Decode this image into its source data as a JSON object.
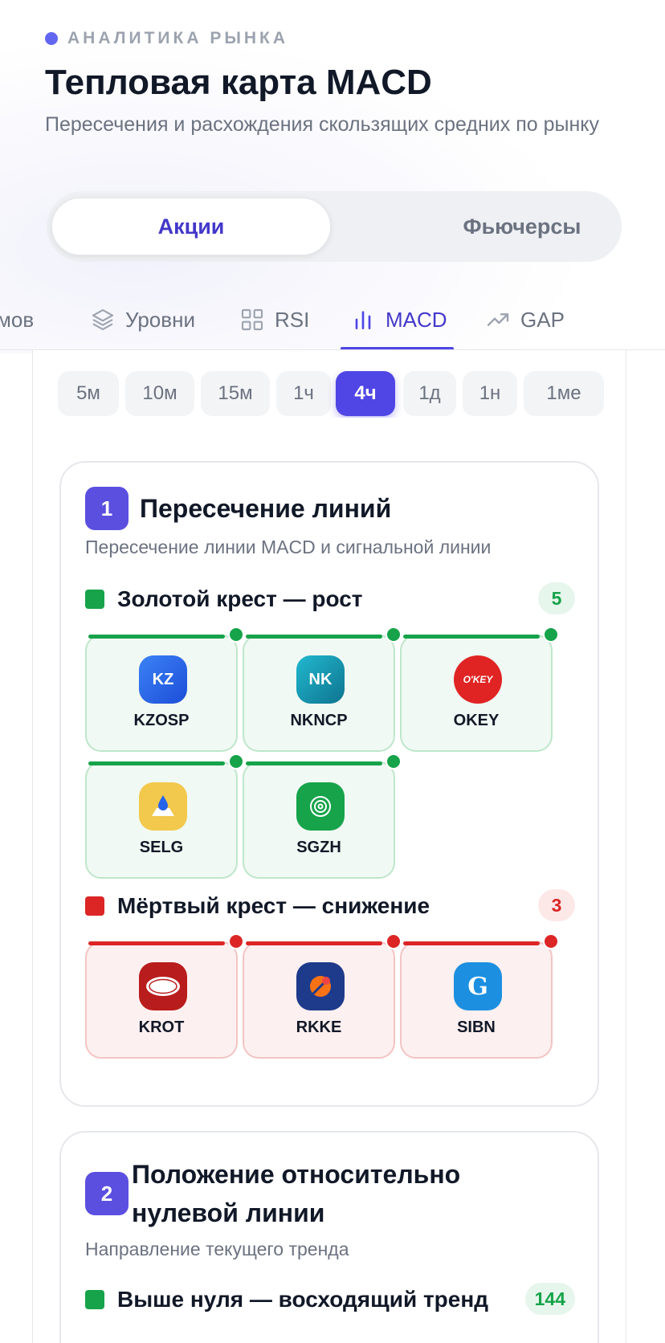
{
  "header": {
    "eyebrow": "АНАЛИТИКА РЫНКА",
    "title": "Тепловая карта MACD",
    "subtitle": "Пересечения и расхождения скользящих средних по рынку"
  },
  "segment": {
    "options": [
      "Акции",
      "Фьючерсы"
    ],
    "selected": "Акции"
  },
  "tabs": [
    {
      "label": "мов",
      "icon": ""
    },
    {
      "label": "Уровни",
      "icon": "layers-icon"
    },
    {
      "label": "RSI",
      "icon": "grid-icon"
    },
    {
      "label": "MACD",
      "icon": "bar-chart-icon",
      "active": true
    },
    {
      "label": "GAP",
      "icon": "trending-up-icon"
    }
  ],
  "timeframes": {
    "items": [
      "5м",
      "10м",
      "15м",
      "1ч",
      "4ч",
      "1д",
      "1н",
      "1ме"
    ],
    "selected": "4ч"
  },
  "sections": [
    {
      "number": "1",
      "title": "Пересечение линий",
      "subtitle": "Пересечение линии MACD и сигнальной линии",
      "groups": [
        {
          "label": "Золотой крест — рост",
          "count": "5",
          "tone": "green",
          "tickers": [
            {
              "symbol": "KZOSP",
              "logo_text": "KZ",
              "logo_color": "#2563eb"
            },
            {
              "symbol": "NKNCP",
              "logo_text": "NK",
              "logo_color": "#0891b2"
            },
            {
              "symbol": "OKEY",
              "logo_text": "O'KEY",
              "logo_color": "#dc2626"
            },
            {
              "symbol": "SELG",
              "logo_text": "",
              "logo_color": "#f2c94c"
            },
            {
              "symbol": "SGZH",
              "logo_text": "",
              "logo_color": "#16a34a"
            }
          ]
        },
        {
          "label": "Мёртвый крест — снижение",
          "count": "3",
          "tone": "red",
          "tickers": [
            {
              "symbol": "KROT",
              "logo_text": "",
              "logo_color": "#b91c1c"
            },
            {
              "symbol": "RKKE",
              "logo_text": "",
              "logo_color": "#1e3a8a"
            },
            {
              "symbol": "SIBN",
              "logo_text": "G",
              "logo_color": "#1d8fe0"
            }
          ]
        }
      ]
    },
    {
      "number": "2",
      "title_line1": "Положение относительно",
      "title_line2": "нулевой линии",
      "subtitle": "Направление текущего тренда",
      "groups": [
        {
          "label": "Выше нуля — восходящий тренд",
          "count": "144",
          "tone": "green"
        }
      ]
    }
  ]
}
